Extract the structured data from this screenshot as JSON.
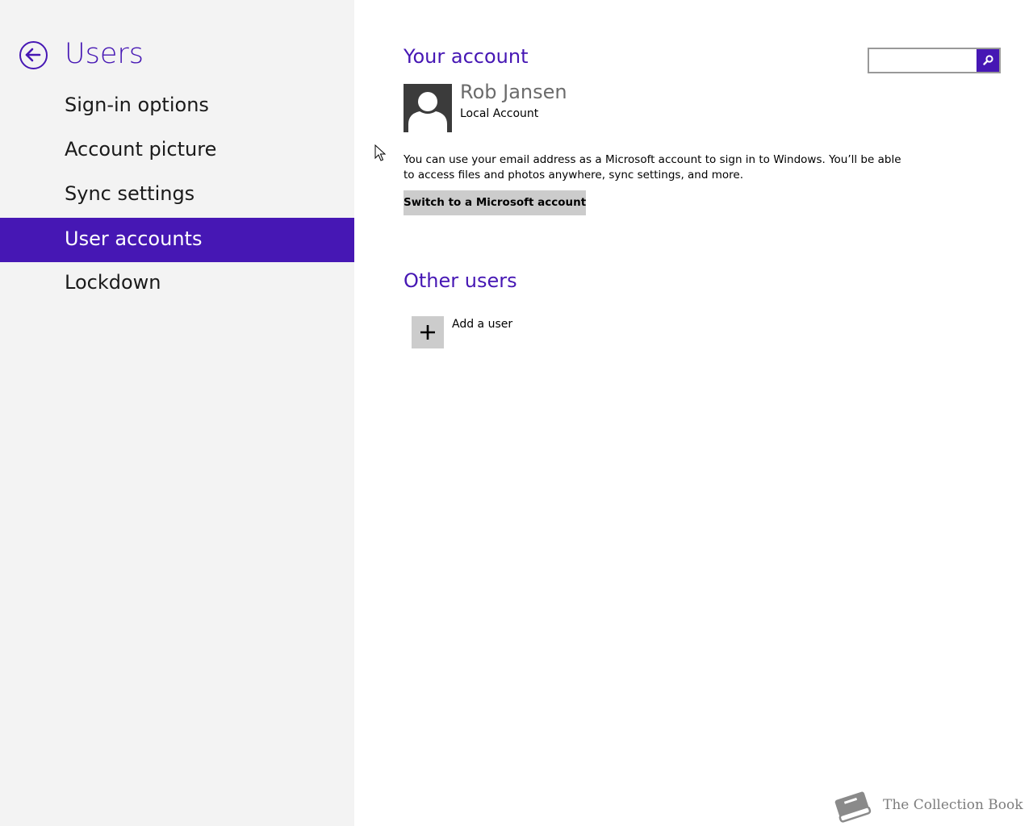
{
  "colors": {
    "accent": "#4617b4",
    "sidebar_bg": "#f3f3f3",
    "button_bg": "#cccccc",
    "avatar_bg": "#3b3b3b"
  },
  "sidebar": {
    "back_icon": "back-arrow-icon",
    "title": "Users",
    "items": [
      {
        "label": "Sign-in options",
        "selected": false
      },
      {
        "label": "Account picture",
        "selected": false
      },
      {
        "label": "Sync settings",
        "selected": false
      },
      {
        "label": "User accounts",
        "selected": true
      },
      {
        "label": "Lockdown",
        "selected": false
      }
    ]
  },
  "search": {
    "value": "",
    "placeholder": "",
    "icon": "search-icon"
  },
  "your_account": {
    "heading": "Your account",
    "avatar_icon": "user-silhouette-icon",
    "user_name": "Rob Jansen",
    "account_type": "Local Account",
    "description": "You can use your email address as a Microsoft account to sign in to Windows. You’ll be able to access files and photos anywhere, sync settings, and more.",
    "switch_button": "Switch to a Microsoft account"
  },
  "other_users": {
    "heading": "Other users",
    "add_icon": "plus-icon",
    "add_label": "Add a user"
  },
  "watermark": {
    "icon": "book-icon",
    "text": "The Collection Book"
  }
}
